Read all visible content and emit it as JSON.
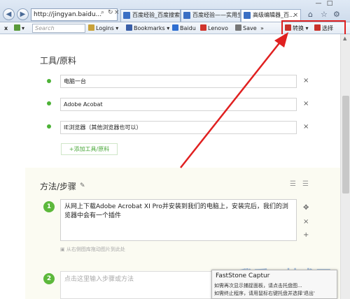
{
  "browser": {
    "address_url": "http://jingyan.baidu...",
    "tabs": [
      {
        "label": "百度经验_百度搜索"
      },
      {
        "label": "百度经验——实用生..."
      },
      {
        "label": "高级编辑器_百..."
      }
    ],
    "window_controls": {
      "minimize": "—",
      "maximize": "□"
    }
  },
  "toolbar": {
    "close_label": "x",
    "search_placeholder": "Search",
    "logins_label": "Logins",
    "bookmarks_label": "Bookmarks",
    "baidu_label": "Baidu",
    "lenovo_label": "Lenovo",
    "save_label": "Save",
    "convert_label": "转换",
    "select_label": "选择"
  },
  "tools_section": {
    "title": "工具/原料",
    "items": [
      {
        "value": "电脑一台"
      },
      {
        "value": "Adobe Acobat"
      },
      {
        "value": "IE浏览器（其他浏览器也可以）"
      }
    ],
    "delete_symbol": "×",
    "add_button_label": "+添加工具/原料"
  },
  "method_section": {
    "title": "方法/步骤",
    "steps": [
      {
        "number": "1",
        "text": "从网上下载Adobe Acrobat XI Pro并安装到我们的电脑上，安装完后，我们的浏览器中会有一个插件"
      },
      {
        "number": "2",
        "placeholder": "点击这里输入步骤或方法"
      }
    ],
    "image_hint": "从右侧图库拖动图片到此处",
    "move_symbol": "✥",
    "delete_symbol": "×",
    "add_symbol": "+"
  },
  "popup": {
    "title": "FastStone Captur",
    "lines": [
      "如需再次显示捕捉面板，请点击托盘图...",
      "如需终止程序，请用鼠标右键托盘并选择'退出'"
    ]
  },
  "watermark": "我爱IT技术网",
  "colors": {
    "accent_green": "#4cb236",
    "annotation_red": "#e02020"
  }
}
